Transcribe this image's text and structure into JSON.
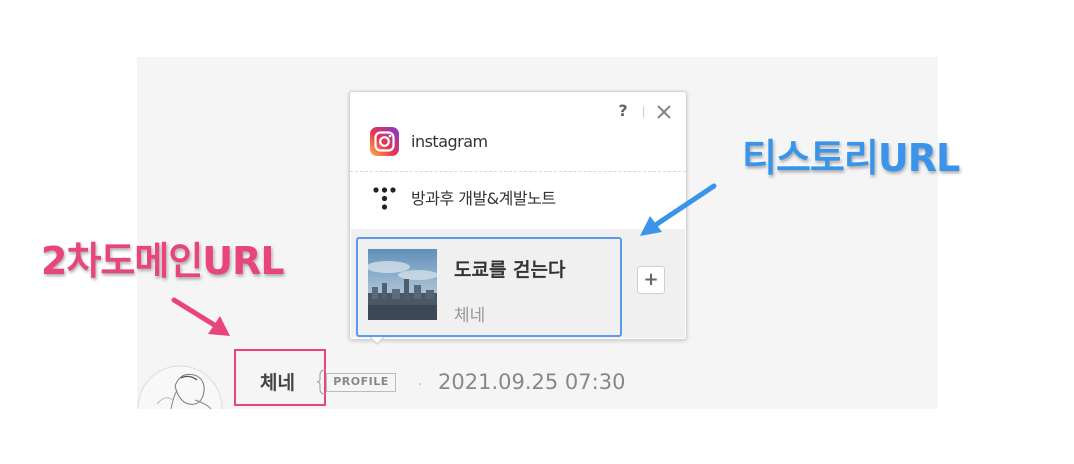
{
  "popup": {
    "help_label": "?",
    "links": [
      {
        "label": "instagram",
        "icon": "instagram-icon"
      },
      {
        "label": "방과후 개발&계발노트",
        "icon": "tistory-icon"
      }
    ],
    "blog_card": {
      "title": "도쿄를 걷는다",
      "author": "체네"
    },
    "add_label": "+"
  },
  "author": {
    "name": "체네",
    "profile_badge": "PROFILE",
    "separator": "·",
    "date": "2021.09.25 07:30"
  },
  "annotations": {
    "tistory_url": "티스토리URL",
    "secondary_domain_url": "2차도메인URL"
  },
  "colors": {
    "tistory_annotation": "#3a95ea",
    "domain_annotation": "#e8457a",
    "highlight_box_blue": "#5b9bea",
    "highlight_box_pink": "#e8457a"
  }
}
